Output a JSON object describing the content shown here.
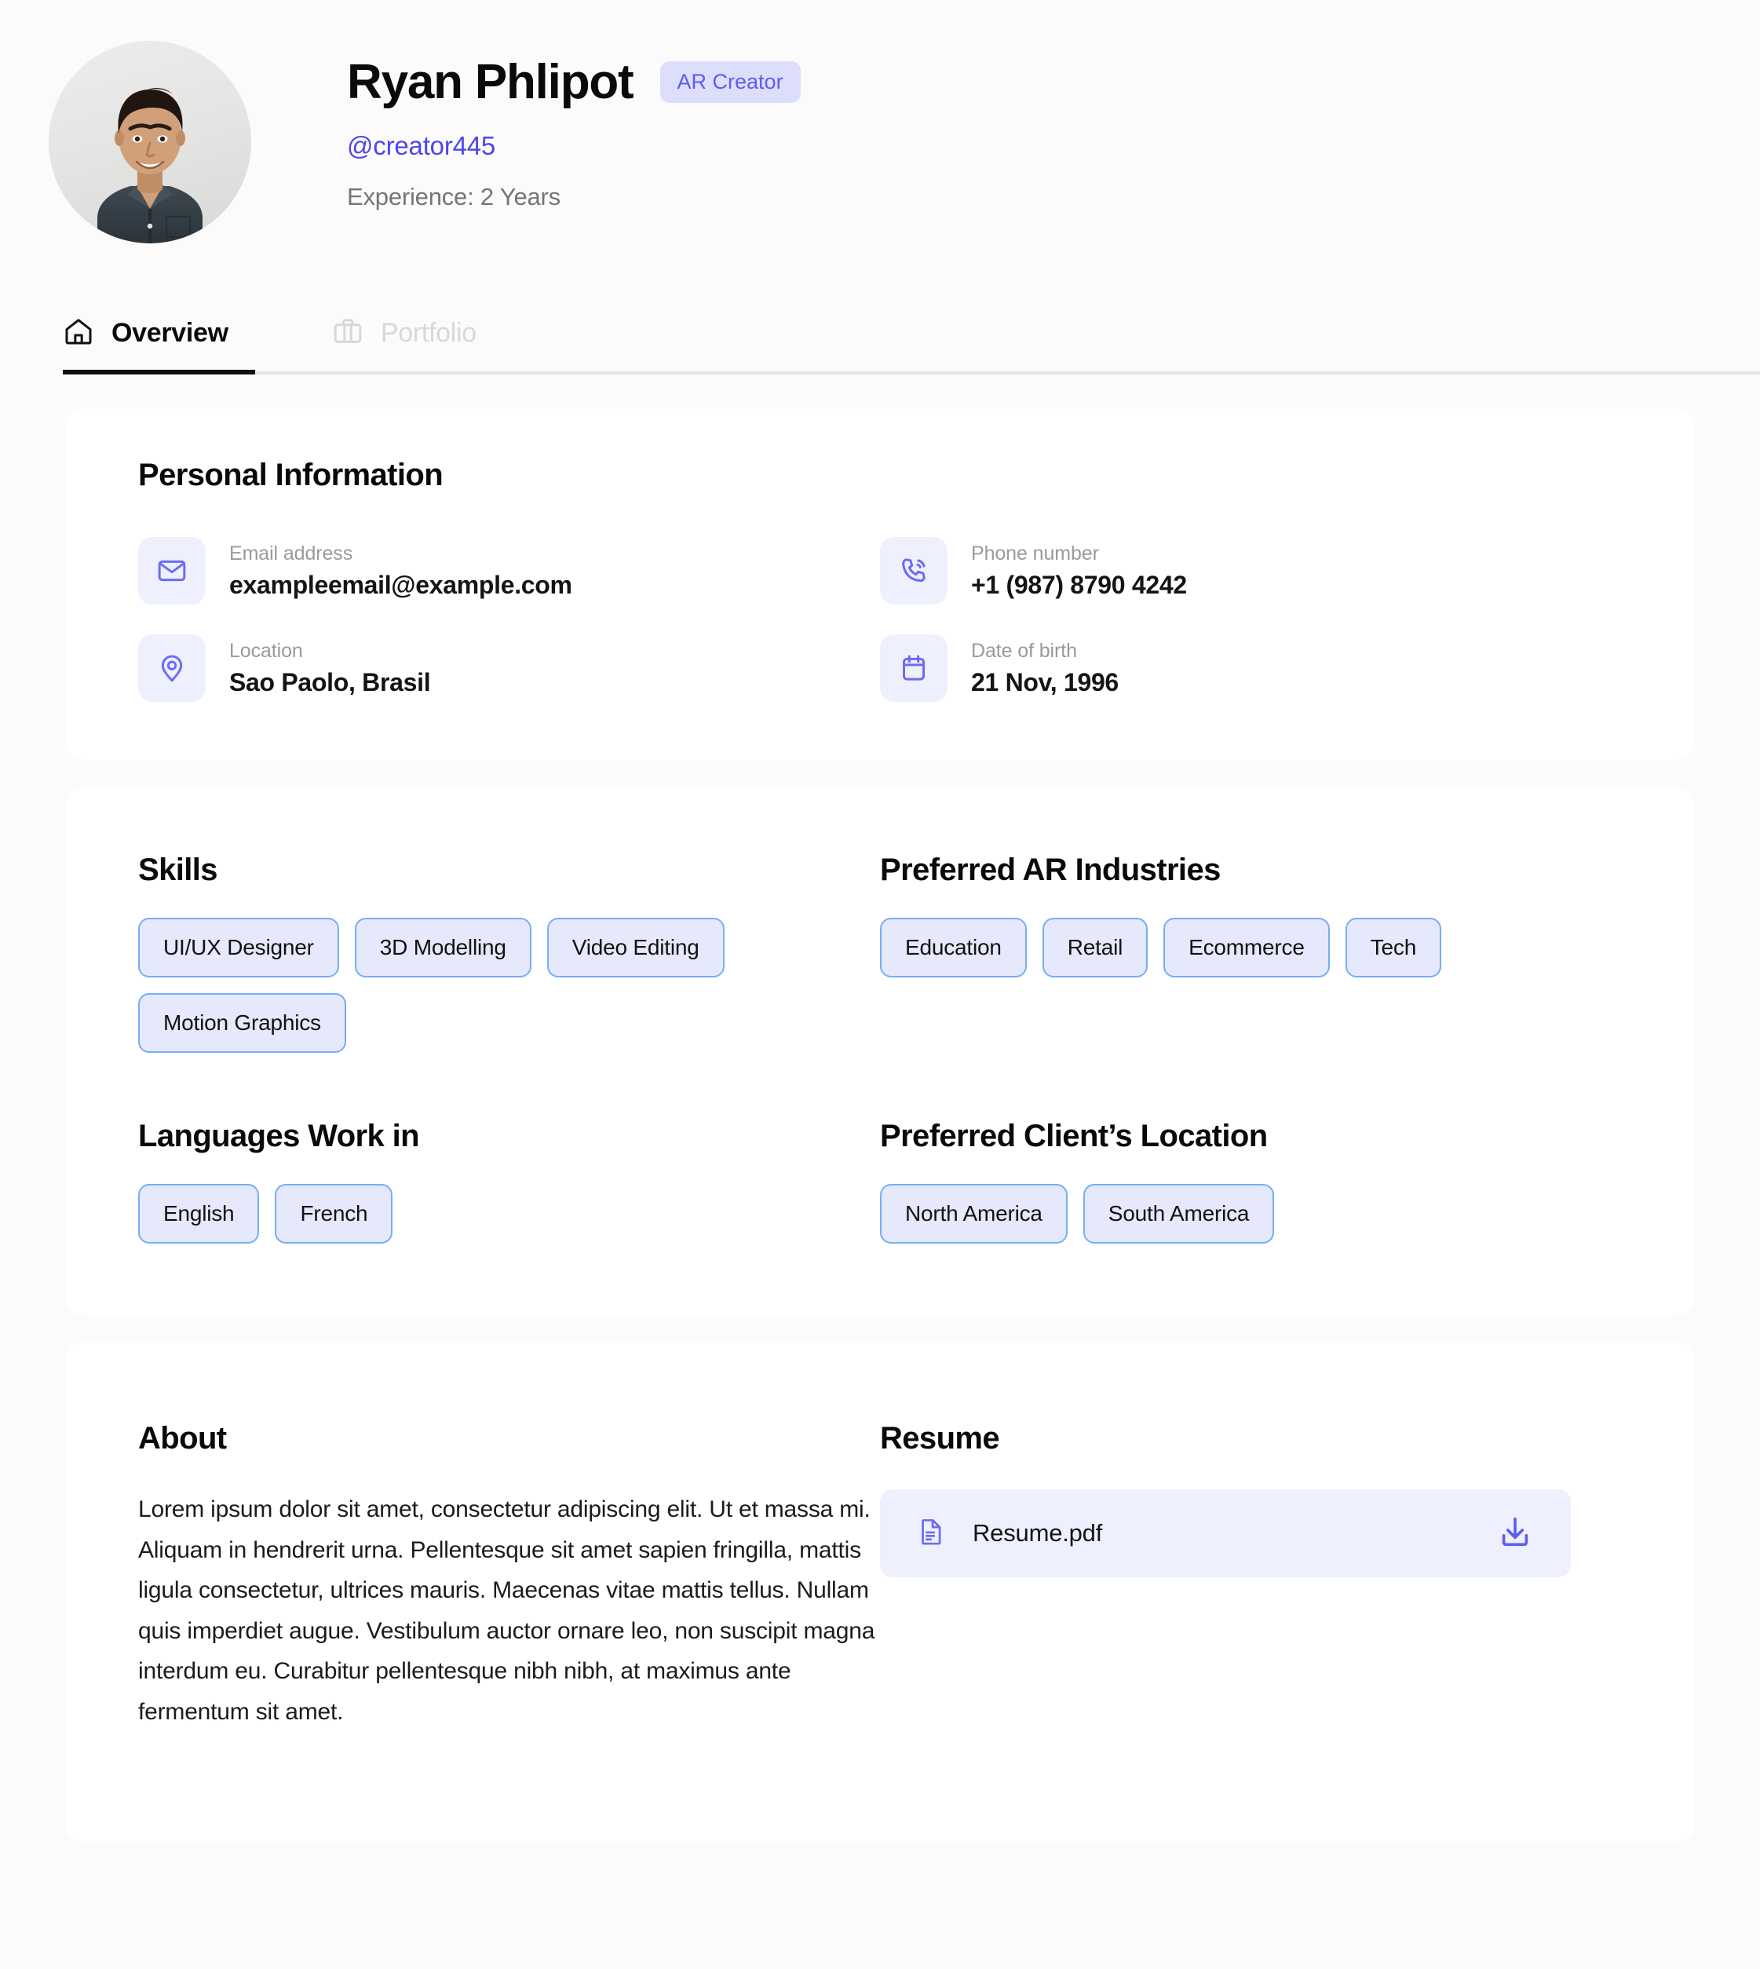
{
  "profile": {
    "name": "Ryan Phlipot",
    "role_badge": "AR Creator",
    "handle": "@creator445",
    "experience": "Experience: 2 Years",
    "avatar_alt": "profile-photo"
  },
  "tabs": [
    {
      "label": "Overview",
      "icon": "home-icon",
      "active": true
    },
    {
      "label": "Portfolio",
      "icon": "briefcase-icon",
      "active": false
    }
  ],
  "personal_information": {
    "title": "Personal Information",
    "items": [
      {
        "label": "Email address",
        "value": "exampleemail@example.com",
        "icon": "mail-icon"
      },
      {
        "label": "Phone number",
        "value": "+1 (987) 8790 4242",
        "icon": "phone-icon"
      },
      {
        "label": "Location",
        "value": "Sao Paolo, Brasil",
        "icon": "map-pin-icon"
      },
      {
        "label": "Date of birth",
        "value": "21 Nov, 1996",
        "icon": "calendar-icon"
      }
    ]
  },
  "skills": {
    "title": "Skills",
    "tags": [
      "UI/UX Designer",
      "3D Modelling",
      "Video Editing",
      "Motion Graphics"
    ]
  },
  "industries": {
    "title": "Preferred AR Industries",
    "tags": [
      "Education",
      "Retail",
      "Ecommerce",
      "Tech"
    ]
  },
  "languages": {
    "title": "Languages Work in",
    "tags": [
      "English",
      "French"
    ]
  },
  "client_location": {
    "title": "Preferred Client’s Location",
    "tags": [
      "North America",
      "South America"
    ]
  },
  "about": {
    "title": "About",
    "body": "Lorem ipsum dolor sit amet, consectetur adipiscing elit. Ut et massa mi. Aliquam in hendrerit urna. Pellentesque sit amet sapien fringilla, mattis ligula consectetur, ultrices mauris. Maecenas vitae mattis tellus. Nullam quis imperdiet augue. Vestibulum auctor ornare leo, non suscipit magna interdum eu. Curabitur pellentesque nibh nibh, at maximus ante fermentum sit amet."
  },
  "resume": {
    "title": "Resume",
    "file_name": "Resume.pdf",
    "file_icon": "document-icon",
    "download_icon": "download-icon"
  },
  "colors": {
    "accent": "#5D5DF0",
    "handle_link": "#4F46E5",
    "tag_border": "#76AEF5",
    "tag_fill": "#E6E8FB",
    "icon_box_fill": "#EEF0FE",
    "badge_fill": "#DDDEFC",
    "page_bg": "#FBFBFB",
    "card_bg": "#FFFFFF",
    "active_tab": "#111111",
    "inactive_tab": "#D8D8D8"
  }
}
